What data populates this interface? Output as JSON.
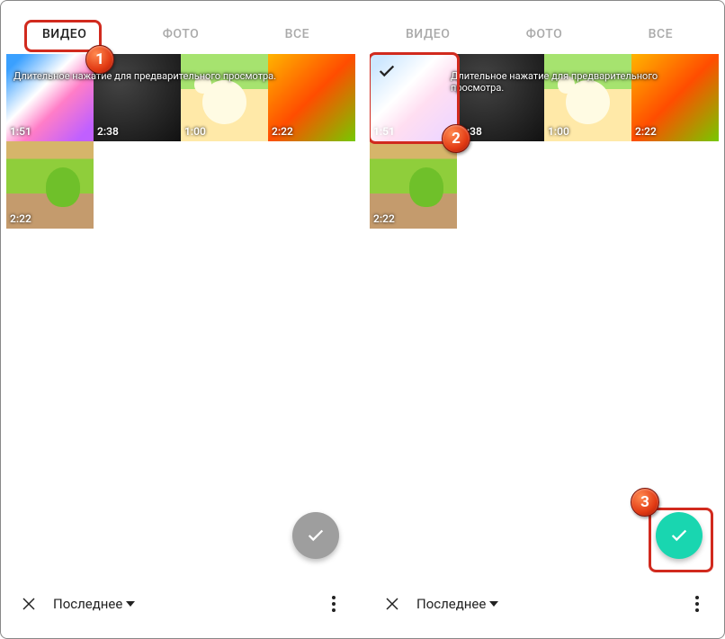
{
  "tabs": {
    "video": "ВИДЕО",
    "photo": "ФОТО",
    "all": "ВСЕ"
  },
  "tip": "Длительное нажатие для предварительного просмотра.",
  "thumbs": {
    "d1": "1:51",
    "d2": "2:38",
    "d3": "1:00",
    "d4": "2:22",
    "d5": "2:22"
  },
  "bottom": {
    "filter": "Последнее"
  },
  "callouts": {
    "c1": "1",
    "c2": "2",
    "c3": "3"
  }
}
